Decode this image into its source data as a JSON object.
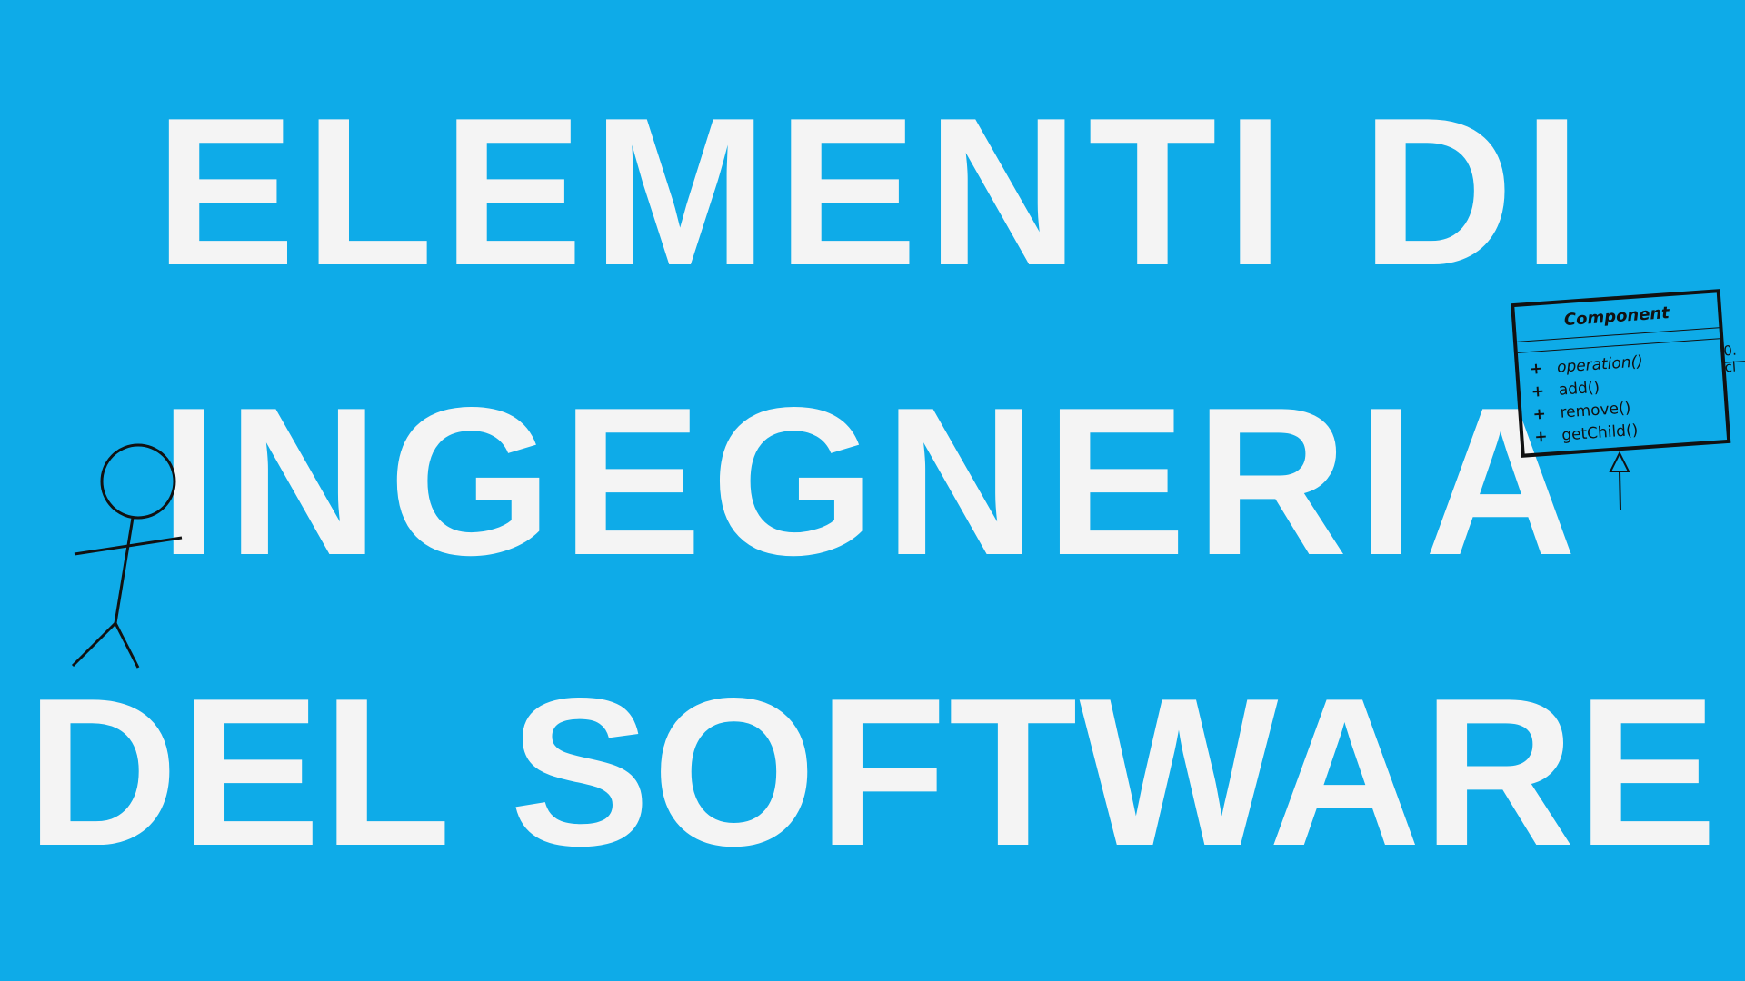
{
  "title": {
    "line1": "ELEMENTI DI",
    "line2": "INGEGNERIA",
    "line3": "DEL SOFTWARE"
  },
  "uml": {
    "class_name": "Component",
    "operations": [
      {
        "visibility": "+",
        "name": "operation()",
        "italic": true
      },
      {
        "visibility": "+",
        "name": "add()",
        "italic": false
      },
      {
        "visibility": "+",
        "name": "remove()",
        "italic": false
      },
      {
        "visibility": "+",
        "name": "getChild()",
        "italic": false
      }
    ],
    "association_multiplicity": "0.",
    "association_role": "cl"
  },
  "colors": {
    "background": "#0eabe8",
    "title_text": "#f4f4f4",
    "drawing_stroke": "#111111"
  },
  "icons": {
    "figure": "stick-figure-icon",
    "inheritance": "inheritance-arrow-icon"
  }
}
